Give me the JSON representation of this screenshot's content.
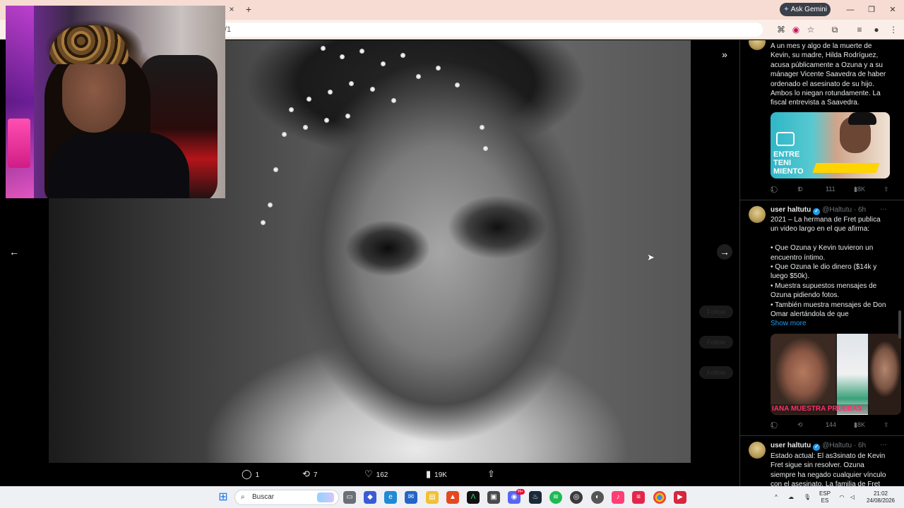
{
  "browser": {
    "url_fragment": "/1",
    "ask_gemini_label": "Ask Gemini",
    "new_tab_symbol": "+",
    "close_tab_symbol": "×"
  },
  "viewer": {
    "expand_symbol": "»",
    "prev_symbol": "←",
    "next_symbol": "→",
    "faded_buttons": [
      "Follow",
      "Follow",
      "Follow"
    ],
    "actions": {
      "replies": "1",
      "reposts": "7",
      "likes": "162",
      "views": "19K"
    }
  },
  "timeline": {
    "tweet1": {
      "lines": [
        "A un mes y algo de la muerte de",
        "Kevin, su madre, Hilda Rodríguez,",
        "acusa públicamente a Ozuna y a su",
        "mánager Vicente Saavedra de haber",
        "ordenado el asesinato de su hijo.",
        "Ambos lo niegan rotundamente. La",
        "fiscal entrevista a Saavedra."
      ],
      "media_text": [
        "ENTRE",
        "TENI",
        "MIENTO"
      ],
      "metrics": {
        "replies": "1",
        "reposts": "1",
        "likes": "111",
        "views": "18K"
      }
    },
    "tweet2": {
      "user": "user haltutu",
      "handle": "@Haltutu · 6h",
      "lines": [
        "2021 – La hermana de Fret publica",
        "un video largo en el que afirma:",
        "",
        "• Que Ozuna y Kevin tuvieron un",
        "encuentro íntimo.",
        "• Que Ozuna le dio dinero ($14k y",
        "luego $50k).",
        "• Muestra supuestos mensajes de",
        "Ozuna pidiendo fotos.",
        "• También muestra mensajes de Don",
        "Omar alertándola de que"
      ],
      "show_more": "Show more",
      "media_caption": "IANA MUESTRA PRUEBAS",
      "metrics": {
        "replies": "1",
        "reposts": "",
        "likes": "144",
        "views": "18K"
      }
    },
    "tweet3": {
      "user": "user haltutu",
      "handle": "@Haltutu · 6h",
      "lines": [
        "Estado actual: El as3sinato de Kevin",
        "Fret sigue sin resolver. Ozuna",
        "siempre ha negado cualquier vínculo",
        "con el asesinato. La familia de Fret"
      ]
    }
  },
  "taskbar": {
    "search_placeholder": "Buscar",
    "lang_top": "ESP",
    "lang_bottom": "ES",
    "time": "21:02",
    "date": "24/08/2026",
    "notification_badge": "99+"
  },
  "colors": {
    "accent": "#1d9bf0",
    "tab_bar": "#f6dcd3",
    "taskbar": "#eef0f4"
  }
}
